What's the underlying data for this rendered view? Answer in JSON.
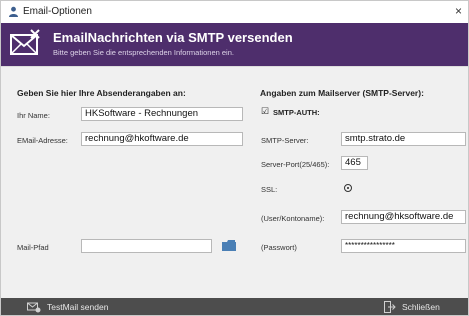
{
  "window": {
    "title": "Email-Optionen",
    "close_glyph": "×"
  },
  "banner": {
    "heading": "EmailNachrichten via SMTP versenden",
    "subtitle": "Bitte geben Sie die entsprechenden Informationen ein.",
    "icon": "envelope-x-icon"
  },
  "sender": {
    "section_title": "Geben Sie hier Ihre Absenderangaben an:",
    "name_label": "Ihr Name:",
    "name_value": "HKSoftware - Rechnungen",
    "email_label": "EMail-Adresse:",
    "email_value": "rechnung@hkoftware.de",
    "mailpath_label": "Mail-Pfad",
    "mailpath_value": ""
  },
  "server": {
    "section_title": "Angaben zum Mailserver (SMTP-Server):",
    "smtp_auth_label": "SMTP-AUTH:",
    "smtp_auth_checked": true,
    "smtp_server_label": "SMTP-Server:",
    "smtp_server_value": "smtp.strato.de",
    "port_label": "Server-Port(25/465):",
    "port_value": "465",
    "ssl_label": "SSL:",
    "ssl_selected": true,
    "user_label": "(User/Kontoname):",
    "user_value": "rechnung@hksoftware.de",
    "password_label": "(Passwort)",
    "password_value": "****************"
  },
  "footer": {
    "testmail_label": "TestMail senden",
    "close_label": "Schließen"
  },
  "colors": {
    "banner": "#4e2e6c",
    "footer": "#4d4d4d",
    "folder": "#4a7fb5"
  }
}
